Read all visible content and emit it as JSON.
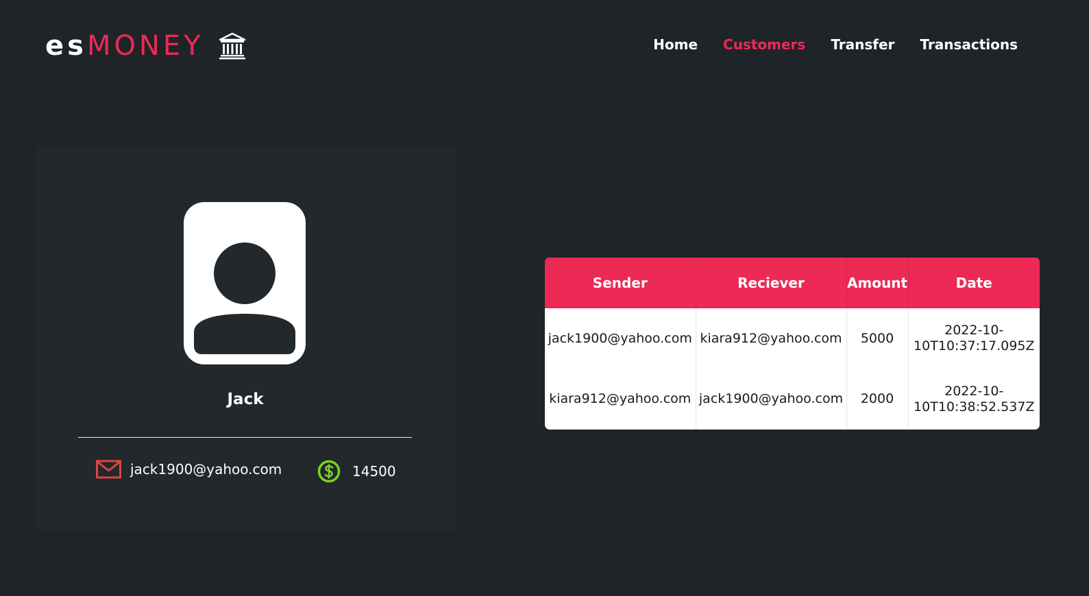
{
  "header": {
    "logo_es": "es",
    "logo_money": "MONEY",
    "logo_icon": "bank-icon",
    "nav": [
      {
        "label": "Home",
        "active": false
      },
      {
        "label": "Customers",
        "active": true
      },
      {
        "label": "Transfer",
        "active": false
      },
      {
        "label": "Transactions",
        "active": false
      }
    ]
  },
  "profile": {
    "name": "Jack",
    "email": "jack1900@yahoo.com",
    "balance": "14500",
    "avatar_icon": "user-avatar-icon",
    "email_icon": "mail-icon",
    "balance_icon": "dollar-circle-icon"
  },
  "transactions": {
    "columns": [
      "Sender",
      "Reciever",
      "Amount",
      "Date"
    ],
    "rows": [
      {
        "sender": "jack1900@yahoo.com",
        "receiver": "kiara912@yahoo.com",
        "amount": "5000",
        "date_line1": "2022-10-",
        "date_line2": "10T10:37:17.095Z"
      },
      {
        "sender": "kiara912@yahoo.com",
        "receiver": "jack1900@yahoo.com",
        "amount": "2000",
        "date_line1": "2022-10-",
        "date_line2": "10T10:38:52.537Z"
      }
    ]
  },
  "colors": {
    "background": "#1f2428",
    "card": "#22282c",
    "accent": "#ec2a55",
    "balance_icon": "#7ed321",
    "mail_icon": "#e0443a"
  }
}
